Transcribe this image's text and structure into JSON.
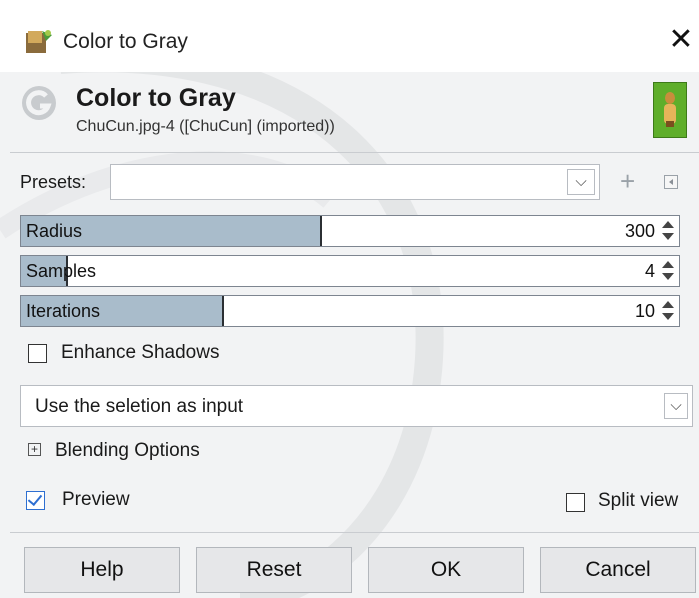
{
  "window": {
    "title": "Color to Gray",
    "close_glyph": "✕",
    "app_icon": "gimp-wilber-icon"
  },
  "header": {
    "title": "Color to Gray",
    "subtitle": "ChuCun.jpg-4 ([ChuCun] (imported))",
    "logo_icon": "gegl-g-icon",
    "thumbnail_icon": "image-thumbnail"
  },
  "presets": {
    "label": "Presets:",
    "value": "",
    "dropdown_glyph": "⌵",
    "add_glyph": "+",
    "menu_icon": "presets-menu-icon"
  },
  "params": [
    {
      "label": "Radius",
      "value": "300",
      "fill_fraction": 0.45
    },
    {
      "label": "Samples",
      "value": "4",
      "fill_fraction": 0.07
    },
    {
      "label": "Iterations",
      "value": "10",
      "fill_fraction": 0.3
    }
  ],
  "enhance_shadows": {
    "label": "Enhance Shadows",
    "checked": false
  },
  "input_combo": {
    "value": "Use the seletion as input",
    "dropdown_glyph": "⌵"
  },
  "blending": {
    "label": "Blending Options",
    "expander_glyph": "+"
  },
  "preview": {
    "label": "Preview",
    "checked": true
  },
  "split_view": {
    "label": "Split view",
    "checked": false
  },
  "buttons": {
    "help": "Help",
    "reset": "Reset",
    "ok": "OK",
    "cancel": "Cancel"
  },
  "colors": {
    "scale_fill": "#a9bccb",
    "check_accent": "#2e6fd1",
    "thumbnail_bg": "#5fae2a"
  }
}
